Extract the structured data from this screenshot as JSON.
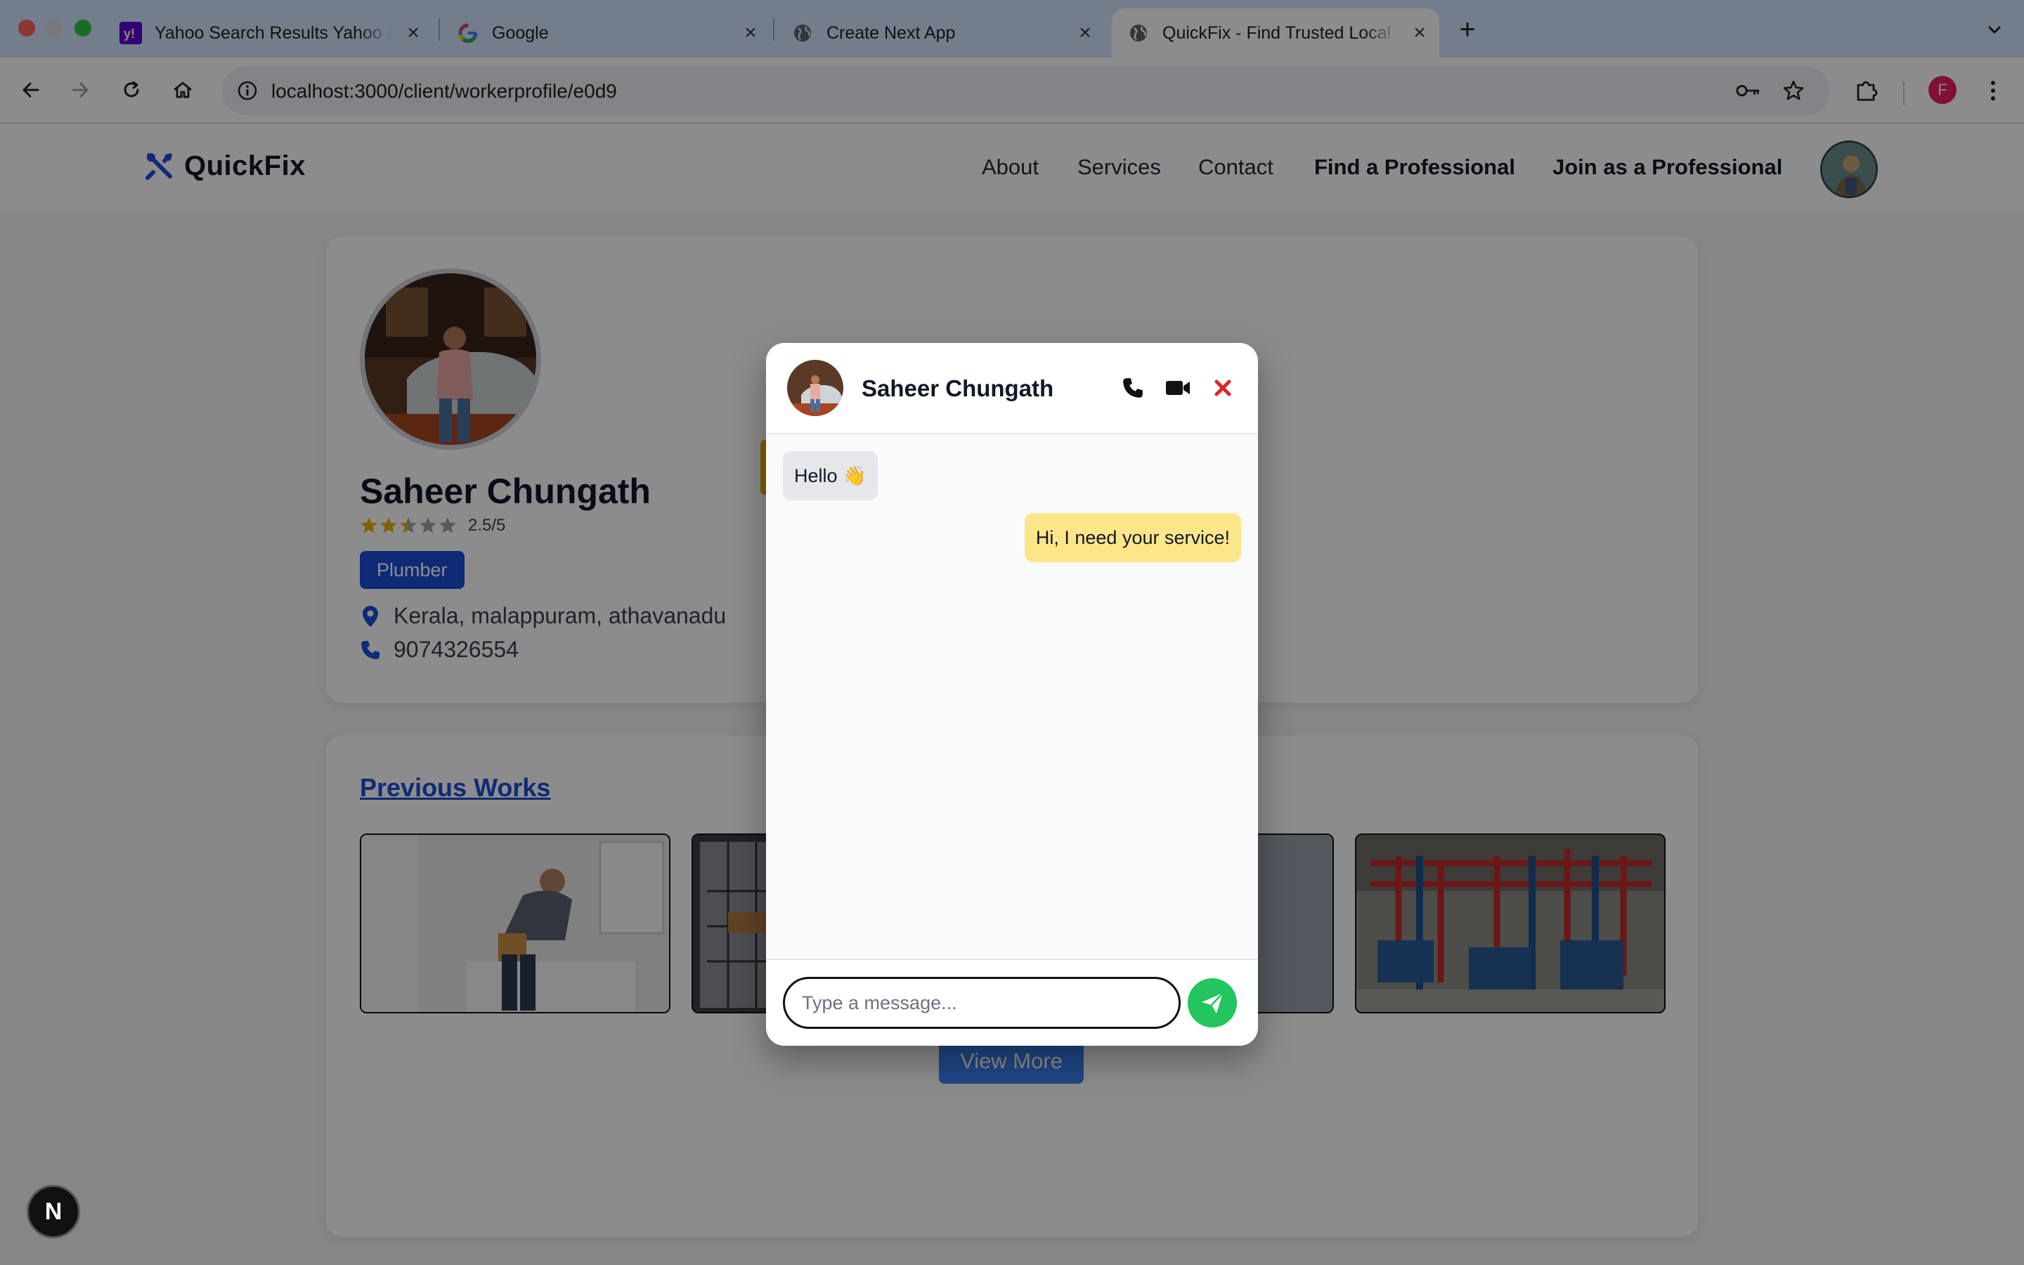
{
  "browser": {
    "tabs": [
      {
        "title": "Yahoo Search Results Yahoo I",
        "favicon": "yahoo-icon"
      },
      {
        "title": "Google",
        "favicon": "google-icon"
      },
      {
        "title": "Create Next App",
        "favicon": "globe-icon"
      },
      {
        "title": "QuickFix - Find Trusted Local",
        "favicon": "globe-icon",
        "active": true
      }
    ],
    "url": "localhost:3000/client/workerprofile/e0d9",
    "profile_initial": "F"
  },
  "site": {
    "brand": "QuickFix",
    "nav": [
      "About",
      "Services",
      "Contact",
      "Find a Professional",
      "Join as a Professional"
    ]
  },
  "profile": {
    "name": "Saheer Chungath",
    "rating": 2.5,
    "rating_text": "2.5/5",
    "role": "Plumber",
    "location": "Kerala, malappuram, athavanadu",
    "phone": "9074326554"
  },
  "works": {
    "title": "Previous Works",
    "view_more": "View More"
  },
  "chat": {
    "name": "Saheer Chungath",
    "messages": [
      {
        "from": "them",
        "text": "Hello 👋"
      },
      {
        "from": "me",
        "text": "Hi, I need your service!"
      }
    ],
    "input_placeholder": "Type a message...",
    "colors": {
      "send": "#22c55e",
      "close": "#dc2626",
      "outgoing": "#fde68a"
    }
  },
  "dev": {
    "next_badge": "N"
  }
}
